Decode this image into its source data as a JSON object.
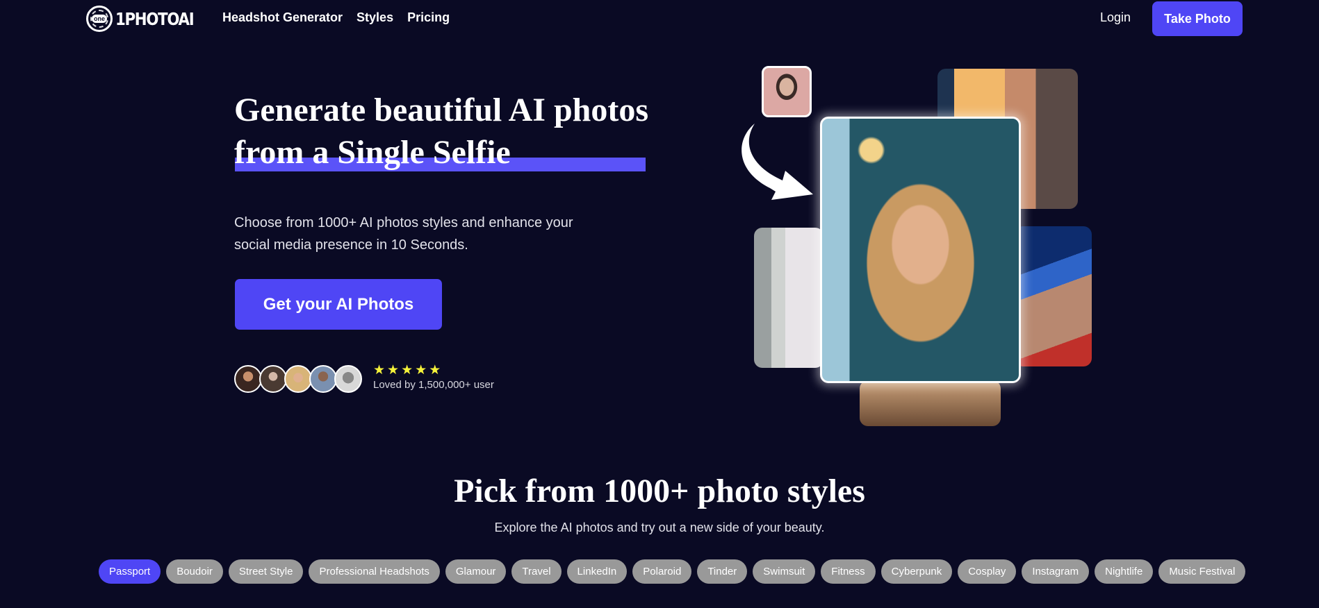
{
  "nav": {
    "logo_badge": "one",
    "logo_text": "1PHOTOAI",
    "links": [
      "Headshot Generator",
      "Styles",
      "Pricing"
    ],
    "login_label": "Login",
    "cta_label": "Take Photo"
  },
  "hero": {
    "title_line1": "Generate beautiful AI photos",
    "title_line2": "from a Single Selfie",
    "subtitle": "Choose from 1000+ AI photos styles and enhance your social media presence in 10 Seconds.",
    "cta_label": "Get your AI Photos",
    "stars": [
      "★",
      "★",
      "★",
      "★",
      "★"
    ],
    "loved_text": "Loved by 1,500,000+ user"
  },
  "styles_section": {
    "title": "Pick from 1000+ photo styles",
    "subtitle": "Explore the AI photos and try out a new side of your beauty.",
    "chips": [
      "Passport",
      "Boudoir",
      "Street Style",
      "Professional Headshots",
      "Glamour",
      "Travel",
      "LinkedIn",
      "Polaroid",
      "Tinder",
      "Swimsuit",
      "Fitness",
      "Cyberpunk",
      "Cosplay",
      "Instagram",
      "Nightlife",
      "Music Festival"
    ],
    "active_chip": "Passport"
  },
  "colors": {
    "background": "#0a0a24",
    "accent": "#4f46f5",
    "chip_inactive": "#999999",
    "star": "#f6f33a"
  }
}
